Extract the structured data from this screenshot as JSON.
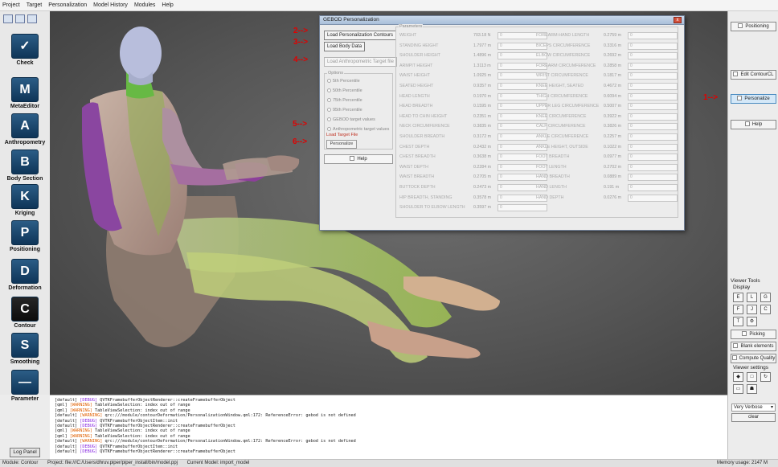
{
  "menu": [
    "Project",
    "Target",
    "Personalization",
    "Model History",
    "Modules",
    "Help"
  ],
  "modules": [
    {
      "label": "Check",
      "glyph": "✓",
      "active": false
    },
    {
      "label": "MetaEditor",
      "glyph": "M",
      "active": false
    },
    {
      "label": "Anthropometry",
      "glyph": "A",
      "active": false
    },
    {
      "label": "Body Section",
      "glyph": "B",
      "active": false
    },
    {
      "label": "Kriging",
      "glyph": "K",
      "active": false
    },
    {
      "label": "Positioning",
      "glyph": "P",
      "active": false
    },
    {
      "label": "Deformation",
      "glyph": "D",
      "active": false
    },
    {
      "label": "Contour",
      "glyph": "C",
      "active": true
    },
    {
      "label": "Smoothing",
      "glyph": "S",
      "active": false
    },
    {
      "label": "Parameter",
      "glyph": "—",
      "active": false
    }
  ],
  "log_panel_button": "Log Panel",
  "right": {
    "positioning": "Positioning",
    "edit_contour": "Edit ContourCL",
    "personalize": "Personalize",
    "help": "Help",
    "viewer_tools": "Viewer Tools",
    "display": "Display",
    "picking": "Picking",
    "blank_elements": "Blank elements",
    "compute_quality": "Compute Quality",
    "viewer_settings": "Viewer settings",
    "tool_glyphs": [
      "E",
      "L",
      "G",
      "F",
      "J",
      "C",
      "T",
      "⚙"
    ],
    "settings_glyphs": [
      "◆",
      "□",
      "↻",
      "▭",
      "☗"
    ]
  },
  "dialog": {
    "title": "GEBOD Personalization",
    "close_glyph": "x",
    "load_contours": "Load Personalization Contours",
    "load_body": "Load Body Data",
    "load_target": "Load Anthropometric Target file",
    "options_label": "Options",
    "options": [
      "5th Percentile",
      "50th Percentile",
      "75th Percentile",
      "95th Percentile",
      "GEBOD target values",
      "Anthropometric target values"
    ],
    "load_target_file": "Load Target File",
    "personalize": "Personalize",
    "help": "Help",
    "parameters_label": "Parameters",
    "params_left": [
      {
        "name": "WEIGHT",
        "value": "703.18 N",
        "input": "0"
      },
      {
        "name": "STANDING HEIGHT",
        "value": "1.7977 m",
        "input": "0"
      },
      {
        "name": "SHOULDER HEIGHT",
        "value": "1.4896 m",
        "input": "0"
      },
      {
        "name": "ARMPIT HEIGHT",
        "value": "1.3113 m",
        "input": "0"
      },
      {
        "name": "WAIST HEIGHT",
        "value": "1.0925 m",
        "input": "0"
      },
      {
        "name": "SEATED HEIGHT",
        "value": "0.9357 m",
        "input": "0"
      },
      {
        "name": "HEAD LENGTH",
        "value": "0.1970 m",
        "input": "0"
      },
      {
        "name": "HEAD BREADTH",
        "value": "0.1595 m",
        "input": "0"
      },
      {
        "name": "HEAD TO CHIN HEIGHT",
        "value": "0.2351 m",
        "input": "0"
      },
      {
        "name": "NECK CIRCUMFERENCE",
        "value": "0.3835 m",
        "input": "0"
      },
      {
        "name": "SHOULDER BREADTH",
        "value": "0.3172 m",
        "input": "0"
      },
      {
        "name": "CHEST DEPTH",
        "value": "0.2432 m",
        "input": "0"
      },
      {
        "name": "CHEST BREADTH",
        "value": "0.3638 m",
        "input": "0"
      },
      {
        "name": "WAIST DEPTH",
        "value": "0.2284 m",
        "input": "0"
      },
      {
        "name": "WAIST BREADTH",
        "value": "0.2705 m",
        "input": "0"
      },
      {
        "name": "BUTTOCK DEPTH",
        "value": "0.2473 m",
        "input": "0"
      },
      {
        "name": "HIP BREADTH, STANDING",
        "value": "0.3578 m",
        "input": "0"
      },
      {
        "name": "SHOULDER TO ELBOW LENGTH",
        "value": "0.3597 m",
        "input": "0"
      }
    ],
    "params_right": [
      {
        "name": "FOREARM-HAND LENGTH",
        "value": "0.2759 m",
        "input": "0"
      },
      {
        "name": "BICEPS CIRCUMFERENCE",
        "value": "0.3316 m",
        "input": "0"
      },
      {
        "name": "ELBOW CIRCUMFERENCE",
        "value": "0.2692 m",
        "input": "0"
      },
      {
        "name": "FOREARM CIRCUMFERENCE",
        "value": "0.2858 m",
        "input": "0"
      },
      {
        "name": "WRIST CIRCUMFERENCE",
        "value": "0.1817 m",
        "input": "0"
      },
      {
        "name": "KNEE HEIGHT, SEATED",
        "value": "0.4672 m",
        "input": "0"
      },
      {
        "name": "THIGH CIRCUMFERENCE",
        "value": "0.6094 m",
        "input": "0"
      },
      {
        "name": "UPPER LEG CIRCUMFERENCE",
        "value": "0.5007 m",
        "input": "0"
      },
      {
        "name": "KNEE CIRCUMFERENCE",
        "value": "0.3922 m",
        "input": "0"
      },
      {
        "name": "CALF CIRCUMFERENCE",
        "value": "0.3826 m",
        "input": "0"
      },
      {
        "name": "ANKLE CIRCUMFERENCE",
        "value": "0.2257 m",
        "input": "0"
      },
      {
        "name": "ANKLE HEIGHT, OUTSIDE",
        "value": "0.1022 m",
        "input": "0"
      },
      {
        "name": "FOOT BREADTH",
        "value": "0.0977 m",
        "input": "0"
      },
      {
        "name": "FOOT LENGTH",
        "value": "0.2702 m",
        "input": "0"
      },
      {
        "name": "HAND BREADTH",
        "value": "0.0889 m",
        "input": "0"
      },
      {
        "name": "HAND LENGTH",
        "value": "0.191 m",
        "input": "0"
      },
      {
        "name": "HAND DEPTH",
        "value": "0.0276 m",
        "input": "0"
      }
    ]
  },
  "annotations": [
    "1-->",
    "2-->",
    "3-->",
    "4-->",
    "5-->",
    "6-->"
  ],
  "log": [
    {
      "tag": "[default]",
      "level": "[DEBUG]",
      "text": "QVTKFramebufferObjectRenderer::createFramebufferObject"
    },
    {
      "tag": "[qml]",
      "level": "[WARNING]",
      "text": "TableViewSelection: index out of range"
    },
    {
      "tag": "[qml]",
      "level": "[WARNING]",
      "text": "TableViewSelection: index out of range"
    },
    {
      "tag": "[default]",
      "level": "[WARNING]",
      "text": "qrc:///module/contourDeformation/PersonalizationWindow.qml:172: ReferenceError: gebod is not defined"
    },
    {
      "tag": "[default]",
      "level": "[DEBUG]",
      "text": "QVTKFramebufferObjectItem::init"
    },
    {
      "tag": "[default]",
      "level": "[DEBUG]",
      "text": "QVTKFramebufferObjectRenderer::createFramebufferObject"
    },
    {
      "tag": "[qml]",
      "level": "[WARNING]",
      "text": "TableViewSelection: index out of range"
    },
    {
      "tag": "[qml]",
      "level": "[WARNING]",
      "text": "TableViewSelection: index out of range"
    },
    {
      "tag": "[default]",
      "level": "[WARNING]",
      "text": "qrc:///module/contourDeformation/PersonalizationWindow.qml:172: ReferenceError: gebod is not defined"
    },
    {
      "tag": "[default]",
      "level": "[DEBUG]",
      "text": "QVTKFramebufferObjectItem::init"
    },
    {
      "tag": "[default]",
      "level": "[DEBUG]",
      "text": "QVTKFramebufferObjectRenderer::createFramebufferObject"
    }
  ],
  "verbosity": "Very Verbose",
  "clear": "clear",
  "status": {
    "module": "Module: Contour",
    "project": "Project: file:///C:/Users/dhruv.piper/piper_install/bin/model.ppj",
    "model": "Current Model: import_model",
    "memory": "Memory usage: 2147 M"
  }
}
